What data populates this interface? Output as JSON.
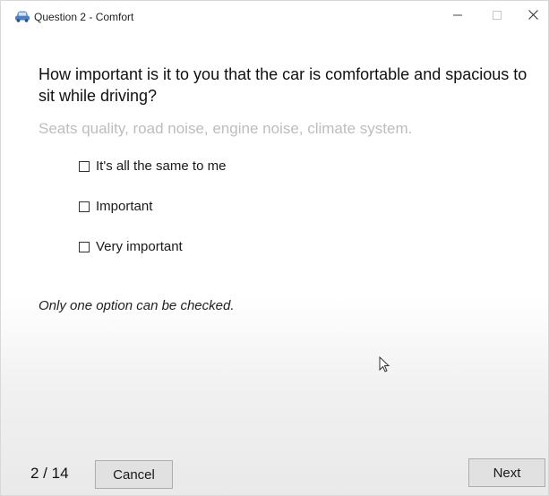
{
  "window": {
    "title": "Question 2 - Comfort",
    "icon": "car-icon",
    "controls": [
      "minimize-icon",
      "maximize-icon",
      "close-icon"
    ]
  },
  "question": {
    "text": "How important is it to you that the car is comfortable and spacious to sit while driving?",
    "hint": "Seats quality, road noise, engine noise, climate system."
  },
  "options": [
    {
      "label": "It's all the same to me",
      "checked": false
    },
    {
      "label": "Important",
      "checked": false
    },
    {
      "label": "Very important",
      "checked": false
    }
  ],
  "note": "Only one option can be checked.",
  "footer": {
    "progress": "2 / 14",
    "cancel_label": "Cancel",
    "next_label": "Next"
  },
  "colors": {
    "hint_text": "#bdbdbd",
    "button_face": "#e1e1e1",
    "button_border": "#adadad",
    "icon_blue": "#4a7fc1"
  }
}
